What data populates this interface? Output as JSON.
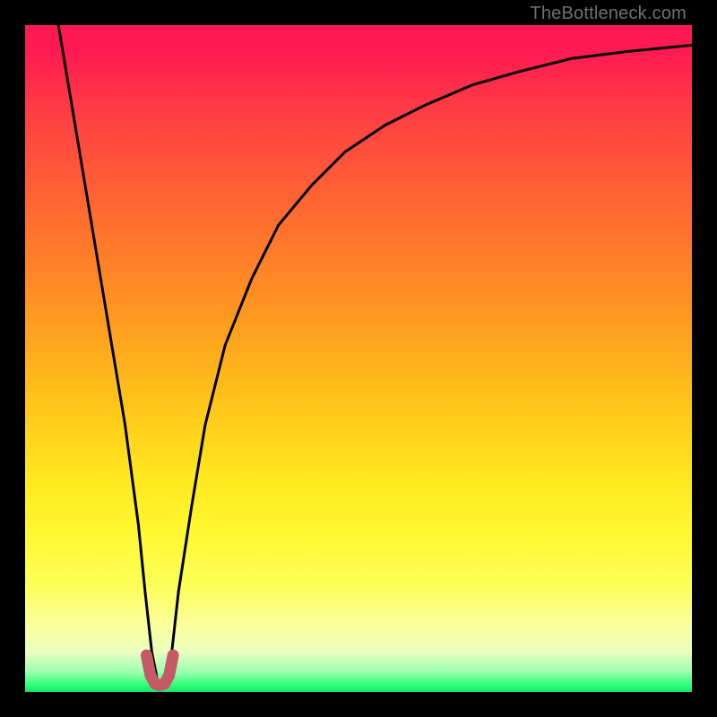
{
  "attribution": "TheBottleneck.com",
  "chart_data": {
    "type": "line",
    "title": "",
    "xlabel": "",
    "ylabel": "",
    "xlim": [
      0,
      100
    ],
    "ylim": [
      0,
      100
    ],
    "series": [
      {
        "name": "curve",
        "x": [
          5,
          7,
          9,
          11,
          13,
          15,
          17,
          18,
          19,
          20,
          21,
          22,
          23,
          25,
          27,
          30,
          34,
          38,
          43,
          48,
          54,
          60,
          67,
          74,
          82,
          90,
          100
        ],
        "values": [
          100,
          88,
          76,
          64,
          52,
          40,
          25,
          15,
          6,
          1,
          1,
          6,
          15,
          28,
          40,
          52,
          62,
          70,
          76,
          81,
          85,
          88,
          91,
          93,
          95,
          96,
          97
        ]
      },
      {
        "name": "trough-marker",
        "x": [
          18.2,
          18.8,
          19.5,
          20.2,
          20.9,
          21.6,
          22.2
        ],
        "values": [
          5.5,
          2.5,
          1.2,
          1.0,
          1.2,
          2.5,
          5.5
        ]
      }
    ],
    "colors": {
      "curve": "#000000",
      "trough": "#c45a63"
    }
  }
}
